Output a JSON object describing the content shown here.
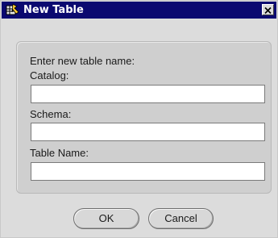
{
  "window": {
    "title": "New Table",
    "app_icon": "table-wizard-icon",
    "close_icon": "close-icon"
  },
  "form": {
    "prompt": "Enter new table name:",
    "catalog_label": "Catalog:",
    "catalog_value": "",
    "schema_label": "Schema:",
    "schema_value": "",
    "table_name_label": "Table Name:",
    "table_name_value": ""
  },
  "buttons": {
    "ok_label": "OK",
    "cancel_label": "Cancel"
  },
  "colors": {
    "titlebar": "#0b0970",
    "window_bg": "#dcdcdc",
    "panel_bg": "#cfcfcf"
  }
}
